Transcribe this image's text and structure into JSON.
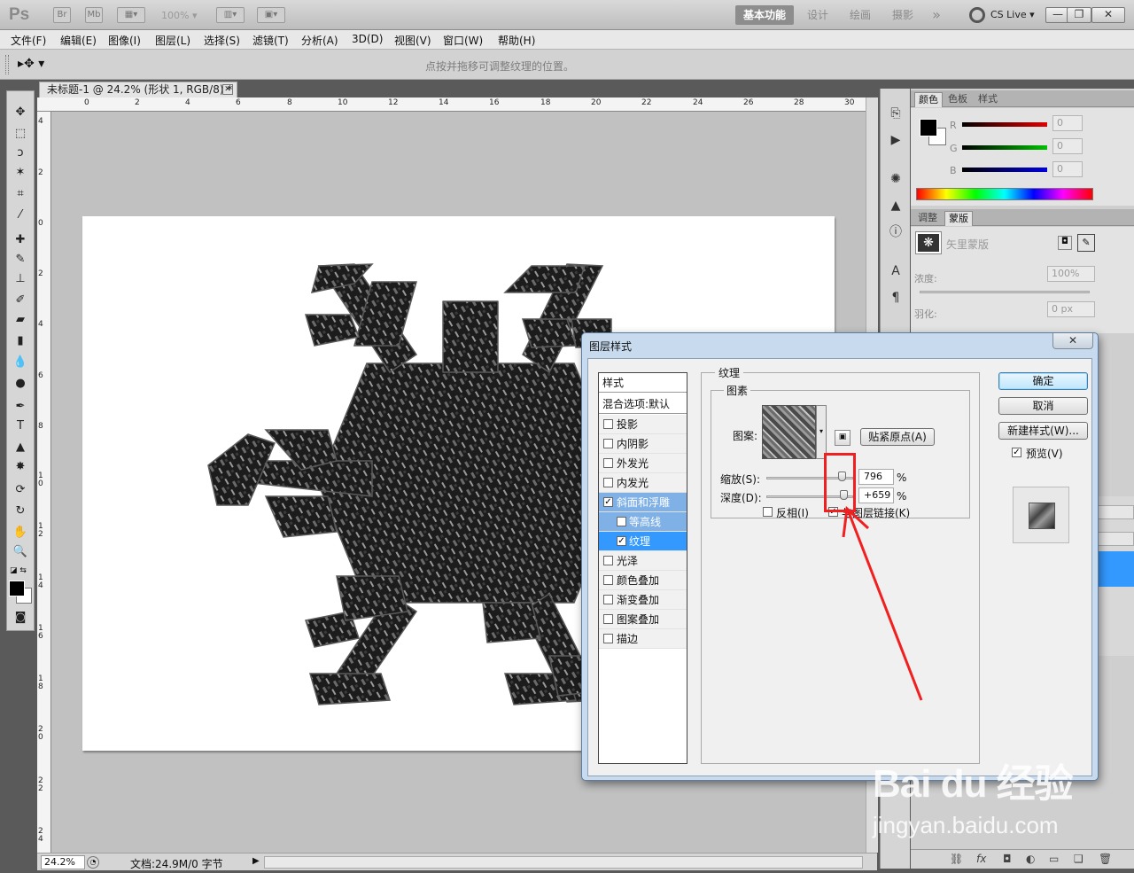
{
  "app": {
    "logo": "Ps",
    "bridge_btn": "Br",
    "mini_bridge_btn": "Mb",
    "zoom_level": "100%",
    "workspaces": [
      "基本功能",
      "设计",
      "绘画",
      "摄影"
    ],
    "overflow": "»",
    "cslive": "CS Live",
    "win_controls": [
      "—",
      "❐",
      "✕"
    ]
  },
  "menu": [
    "文件(F)",
    "编辑(E)",
    "图像(I)",
    "图层(L)",
    "选择(S)",
    "滤镜(T)",
    "分析(A)",
    "3D(D)",
    "视图(V)",
    "窗口(W)",
    "帮助(H)"
  ],
  "options_bar": {
    "hint": "点按并拖移可调整纹理的位置。"
  },
  "document": {
    "tab_title": "未标题-1 @ 24.2% (形状 1, RGB/8) *",
    "ruler_top": [
      "0",
      "2",
      "4",
      "6",
      "8",
      "10",
      "12",
      "14",
      "16",
      "18",
      "20",
      "22",
      "24",
      "26",
      "28",
      "30"
    ],
    "ruler_left": [
      "4",
      "2",
      "0",
      "2",
      "4",
      "6",
      "8",
      "1 0",
      "1 2",
      "1 4",
      "1 6",
      "1 8",
      "2 0",
      "2 2",
      "2 4"
    ]
  },
  "status": {
    "zoom": "24.2%",
    "doc_info": "文档:24.9M/0 字节"
  },
  "panels": {
    "color_tabs": [
      "颜色",
      "色板",
      "样式"
    ],
    "channels": [
      {
        "label": "R",
        "value": "0",
        "color": "#e00000"
      },
      {
        "label": "G",
        "value": "0",
        "color": "#00c000"
      },
      {
        "label": "B",
        "value": "0",
        "color": "#0000e0"
      }
    ],
    "mask_tabs": [
      "调整",
      "蒙版"
    ],
    "mask_label": "矢里蒙版",
    "density_label": "浓度:",
    "density_value": "100%",
    "feather_label": "羽化:",
    "feather_value": "0 px"
  },
  "dialog": {
    "title": "图层样式",
    "close": "✕",
    "styles_header": "样式",
    "blend_options": "混合选项:默认",
    "items": [
      {
        "label": "投影",
        "checked": false
      },
      {
        "label": "内阴影",
        "checked": false
      },
      {
        "label": "外发光",
        "checked": false
      },
      {
        "label": "内发光",
        "checked": false
      },
      {
        "label": "斜面和浮雕",
        "checked": true
      },
      {
        "label": "等高线",
        "checked": false
      },
      {
        "label": "纹理",
        "checked": true
      },
      {
        "label": "光泽",
        "checked": false
      },
      {
        "label": "颜色叠加",
        "checked": false
      },
      {
        "label": "渐变叠加",
        "checked": false
      },
      {
        "label": "图案叠加",
        "checked": false
      },
      {
        "label": "描边",
        "checked": false
      }
    ],
    "texture_title": "纹理",
    "pattern_group": "图素",
    "pattern_label": "图案:",
    "snap_button": "贴紧原点(A)",
    "scale_label": "缩放(S):",
    "scale_value": "796",
    "depth_label": "深度(D):",
    "depth_value": "+659",
    "percent": "%",
    "invert_label": "反相(I)",
    "invert_checked": false,
    "link_label": "与图层链接(K)",
    "link_checked": true,
    "ok": "确定",
    "cancel": "取消",
    "new_style": "新建样式(W)...",
    "preview_label": "预览(V)",
    "preview_checked": true
  },
  "watermark": {
    "brand": "Bai du 经验",
    "url": "jingyan.baidu.com"
  },
  "colors": {
    "accent": "#3399ff",
    "annotation": "#f02020"
  }
}
